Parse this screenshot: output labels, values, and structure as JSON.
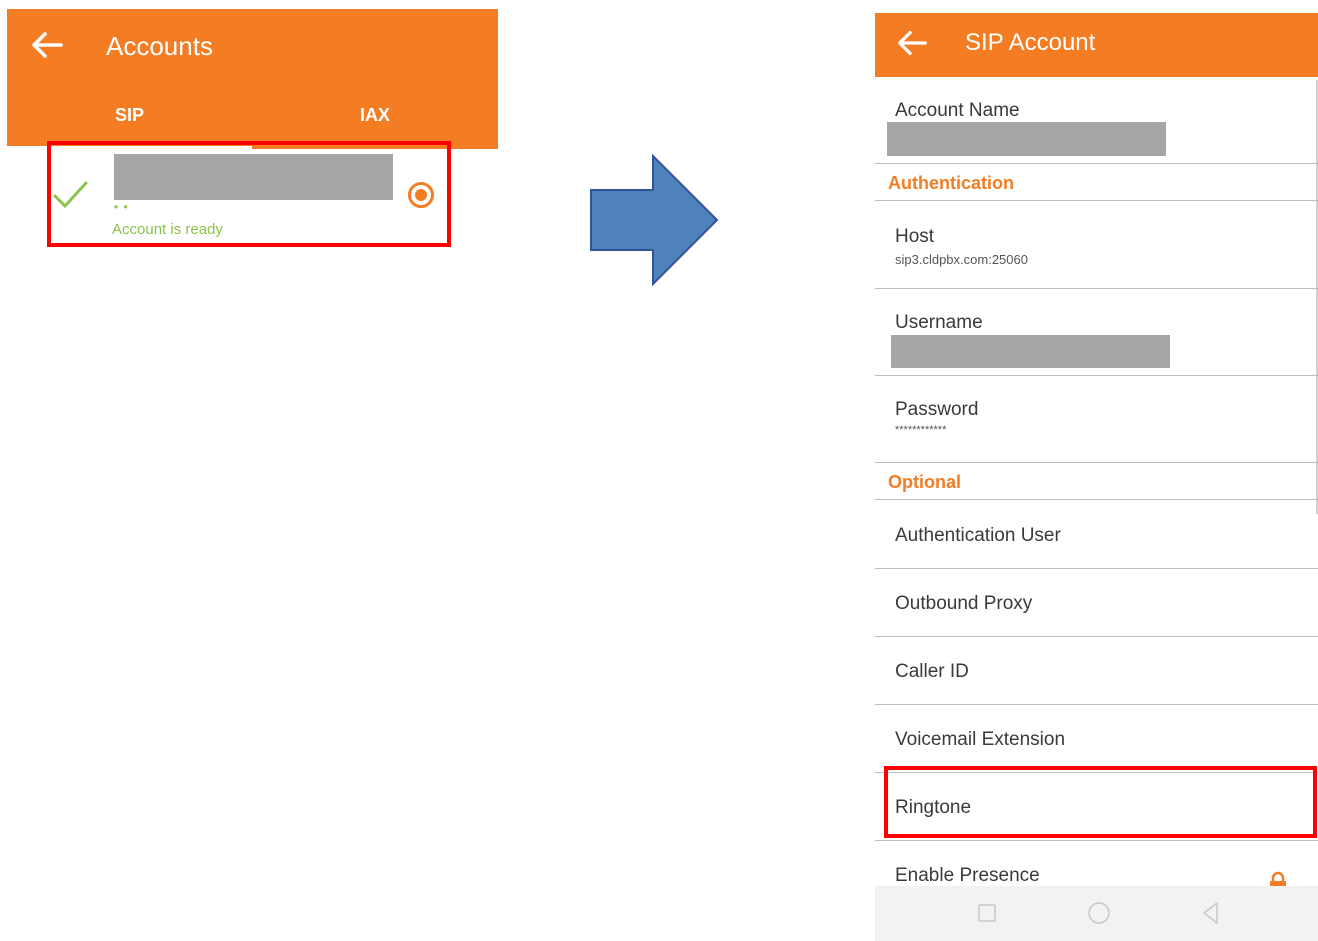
{
  "left_screen": {
    "title": "Accounts",
    "tabs": [
      {
        "label": "SIP"
      },
      {
        "label": "IAX"
      }
    ],
    "account": {
      "name": "",
      "dots": "• •",
      "status": "Account is ready"
    }
  },
  "right_screen": {
    "title": "SIP Account",
    "items": {
      "account_name": {
        "title": "Account Name"
      },
      "authentication_section": "Authentication",
      "host": {
        "title": "Host",
        "value": "sip3.cldpbx.com:25060"
      },
      "username": {
        "title": "Username"
      },
      "password": {
        "title": "Password",
        "value": "************"
      },
      "optional_section": "Optional",
      "auth_user": {
        "title": "Authentication User"
      },
      "outbound_proxy": {
        "title": "Outbound Proxy"
      },
      "caller_id": {
        "title": "Caller ID"
      },
      "voicemail": {
        "title": "Voicemail Extension"
      },
      "ringtone": {
        "title": "Ringtone"
      },
      "presence": {
        "title": "Enable Presence"
      }
    }
  },
  "icons": {
    "back": "back-arrow-icon",
    "check": "check-icon",
    "radio": "radio-selected-icon",
    "flow_arrow": "right-arrow-icon",
    "lock": "lock-icon",
    "nav": [
      "square-recents-icon",
      "circle-home-icon",
      "triangle-back-icon"
    ]
  },
  "colors": {
    "accent": "#f47d24",
    "ready": "#8bc34a",
    "highlight": "#ff0000",
    "arrow": "#4f81bd"
  }
}
